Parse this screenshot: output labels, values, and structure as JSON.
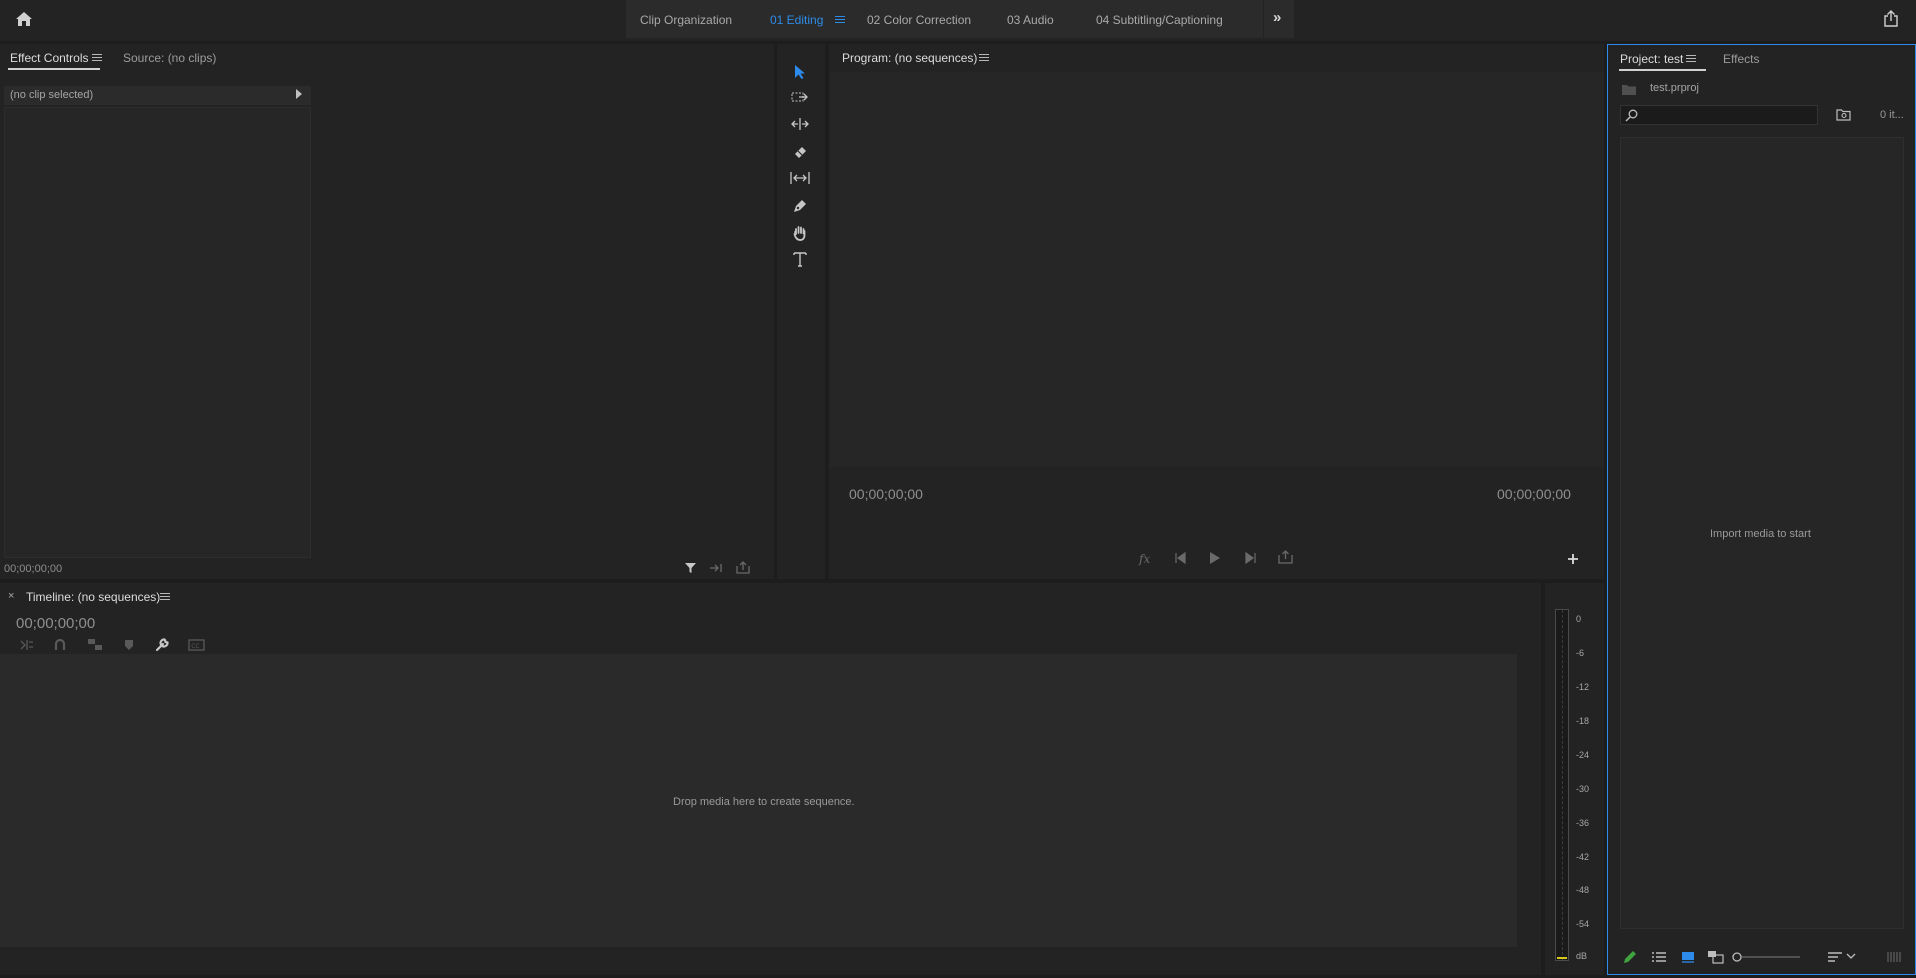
{
  "workspace": {
    "tabs": [
      {
        "label": "Clip Organization",
        "active": false
      },
      {
        "label": "01 Editing",
        "active": true
      },
      {
        "label": "02 Color Correction",
        "active": false
      },
      {
        "label": "03 Audio",
        "active": false
      },
      {
        "label": "04 Subtitling/Captioning",
        "active": false
      }
    ],
    "accent_color": "#2d8ceb"
  },
  "effect_controls": {
    "tab_effect_controls": "Effect Controls",
    "tab_source": "Source: (no clips)",
    "clip_selector": "(no clip selected)",
    "timecode": "00;00;00;00"
  },
  "program": {
    "title": "Program: (no sequences)",
    "timecode_left": "00;00;00;00",
    "timecode_right": "00;00;00;00"
  },
  "project": {
    "tab_project": "Project: test",
    "tab_effects": "Effects",
    "file_name": "test.prproj",
    "search_placeholder": "",
    "item_count": "0 it...",
    "empty_hint": "Import media to start"
  },
  "timeline": {
    "title": "Timeline: (no sequences)",
    "timecode": "00;00;00;00",
    "empty_hint": "Drop media here to create sequence."
  },
  "audio_meter": {
    "ticks": [
      "0",
      "-6",
      "-12",
      "-18",
      "-24",
      "-30",
      "-36",
      "-42",
      "-48",
      "-54",
      "dB"
    ]
  }
}
